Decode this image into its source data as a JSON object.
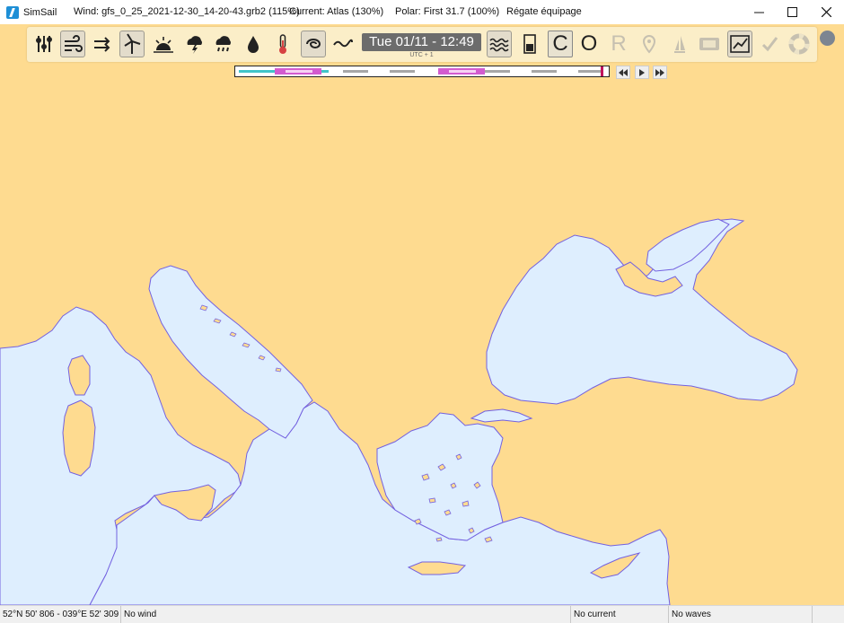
{
  "titlebar": {
    "app_name": "SimSail",
    "wind": "Wind: gfs_0_25_2021-12-30_14-20-43.grb2 (115%)",
    "current": "Current: Atlas (130%)",
    "polar": "Polar: First 31.7 (100%)",
    "boat": "Régate équipage",
    "minimize_icon": "minimize-icon",
    "maximize_icon": "maximize-icon",
    "close_icon": "close-icon"
  },
  "toolbar": {
    "tools": [
      {
        "name": "settings-sliders-icon"
      },
      {
        "name": "wind-icon"
      },
      {
        "name": "wind-arrows-icon"
      },
      {
        "name": "wind-turbine-icon"
      },
      {
        "name": "sunrise-icon"
      },
      {
        "name": "storm-cloud-icon"
      },
      {
        "name": "rain-cloud-icon"
      },
      {
        "name": "humidity-icon"
      },
      {
        "name": "thermometer-icon"
      },
      {
        "name": "cyclone-icon"
      },
      {
        "name": "wave-icon"
      }
    ],
    "date_time": "Tue 01/11 - 12:49",
    "timezone": "UTC + 1",
    "right_tools": [
      {
        "name": "waves-icon"
      },
      {
        "name": "tide-gauge-icon"
      }
    ],
    "letters": {
      "c": "C",
      "o": "O",
      "r": "R"
    },
    "more_tools": [
      {
        "name": "location-pin-icon"
      },
      {
        "name": "sail-icon"
      },
      {
        "name": "calendar-icon"
      },
      {
        "name": "route-chart-icon"
      },
      {
        "name": "checkmark-icon"
      },
      {
        "name": "lifebuoy-icon"
      }
    ]
  },
  "playback": {
    "rewind_icon": "rewind-icon",
    "play_icon": "play-icon",
    "fast_forward_icon": "fast-forward-icon"
  },
  "statusbar": {
    "position": "52°N 50' 806 - 039°E 52' 309",
    "wind": "No wind",
    "current": "No current",
    "waves": "No waves"
  },
  "colors": {
    "land": "#fedb90",
    "sea": "#deeefe",
    "coast": "#7361e0",
    "toolbar_bg": "#fbeec8"
  }
}
